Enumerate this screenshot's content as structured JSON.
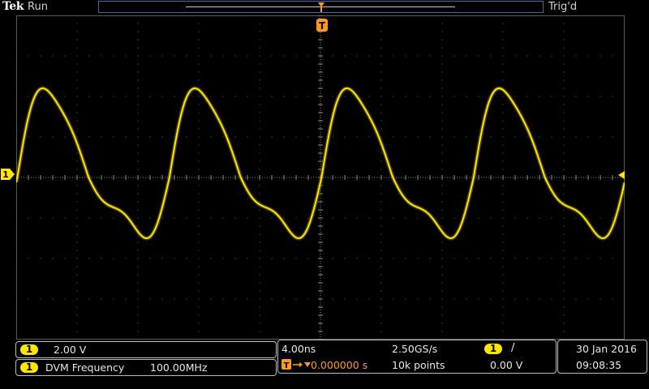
{
  "header": {
    "brand": "Tek",
    "acq_state": "Run",
    "trigger_state": "Trig'd"
  },
  "markers": {
    "channel_number": "1",
    "trigger_position_glyph": "T"
  },
  "vertical": {
    "channel": "1",
    "scale": "2.00 V"
  },
  "measurement": {
    "channel": "1",
    "label": "DVM Frequency",
    "value": "100.00MHz"
  },
  "horizontal": {
    "time_per_div": "4.00ns",
    "sample_rate": "2.50GS/s",
    "trigger_delay": "0.000000 s",
    "record_length": "10k points"
  },
  "trigger": {
    "source": "1",
    "slope_glyph": "/",
    "level": "0.00 V"
  },
  "clock": {
    "date": "30 Jan  2016",
    "time": "09:08:35"
  },
  "colors": {
    "ch1": "#ffe600",
    "trigger": "#ff9a1f",
    "grid": "#3a3a3a",
    "record_border": "#3c6fa8"
  },
  "icons": {
    "channel_marker": "ch1-ground-marker-icon",
    "trigger_level": "trigger-level-arrow-icon",
    "trigger_position": "trigger-position-icon",
    "rising_edge": "rising-edge-icon"
  },
  "chart_data": {
    "type": "line",
    "divisions": {
      "x": 10,
      "y": 8
    },
    "series": [
      {
        "channel": "1",
        "wave": "periodic",
        "period_div": 2.5,
        "phase_div_to_first_rising_zero": 0.0,
        "peak_div": 2.2,
        "trough_div": -1.5
      }
    ]
  }
}
